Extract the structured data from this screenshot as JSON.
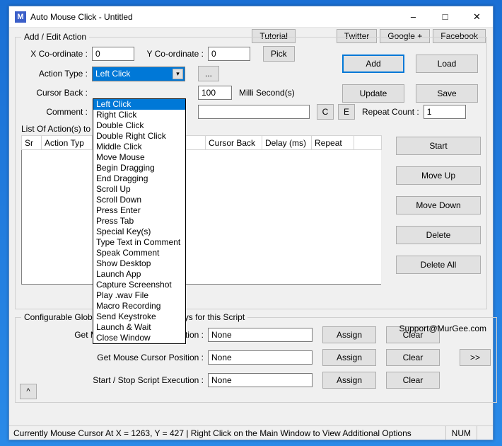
{
  "window": {
    "icon_letter": "M",
    "title": "Auto Mouse Click - Untitled"
  },
  "toplinks": {
    "tutorial": "Tutorial",
    "twitter": "Twitter",
    "google": "Google +",
    "facebook": "Facebook"
  },
  "group_addedit": {
    "legend": "Add / Edit Action",
    "x_label": "X Co-ordinate :",
    "x_value": "0",
    "y_label": "Y Co-ordinate :",
    "y_value": "0",
    "pick": "Pick",
    "action_type_label": "Action Type :",
    "action_type_selected": "Left Click",
    "action_type_more": "...",
    "cursor_back_label": "Cursor Back :",
    "delay_value": "100",
    "delay_unit": "Milli Second(s)",
    "comment_label": "Comment :",
    "comment_value": "",
    "c_btn": "C",
    "e_btn": "E",
    "repeat_label": "Repeat Count :",
    "repeat_value": "1",
    "add": "Add",
    "load": "Load",
    "update": "Update",
    "save": "Save"
  },
  "action_types": [
    "Left Click",
    "Right Click",
    "Double Click",
    "Double Right Click",
    "Middle Click",
    "Move Mouse",
    "Begin Dragging",
    "End Dragging",
    "Scroll Up",
    "Scroll Down",
    "Press Enter",
    "Press Tab",
    "Special Key(s)",
    "Type Text in Comment",
    "Speak Comment",
    "Show Desktop",
    "Launch App",
    "Capture Screenshot",
    "Play .wav File",
    "Macro Recording",
    "Send Keystroke",
    "Launch & Wait",
    "Close Window"
  ],
  "list": {
    "label_prefix": "List Of Action(s) to",
    "columns": [
      "Sr",
      "Action Typ",
      "",
      "",
      "Cursor Back",
      "Delay (ms)",
      "Repeat"
    ],
    "side": {
      "start": "Start",
      "moveup": "Move Up",
      "movedown": "Move Down",
      "delete": "Delete",
      "deleteall": "Delete All"
    }
  },
  "shortcuts": {
    "legend": "Configurable Global Keyboard Shortcut Keys for this Script",
    "support": "Support@MurGee.com",
    "rows": [
      {
        "label": "Get Mouse Position & Add Action :",
        "value": "None"
      },
      {
        "label": "Get Mouse Cursor Position :",
        "value": "None"
      },
      {
        "label": "Start / Stop Script Execution :",
        "value": "None"
      }
    ],
    "assign": "Assign",
    "clear": "Clear",
    "more": ">>",
    "caret": "^"
  },
  "status": {
    "text": "Currently Mouse Cursor At X = 1263, Y = 427 | Right Click on the Main Window to View Additional Options",
    "num": "NUM"
  }
}
